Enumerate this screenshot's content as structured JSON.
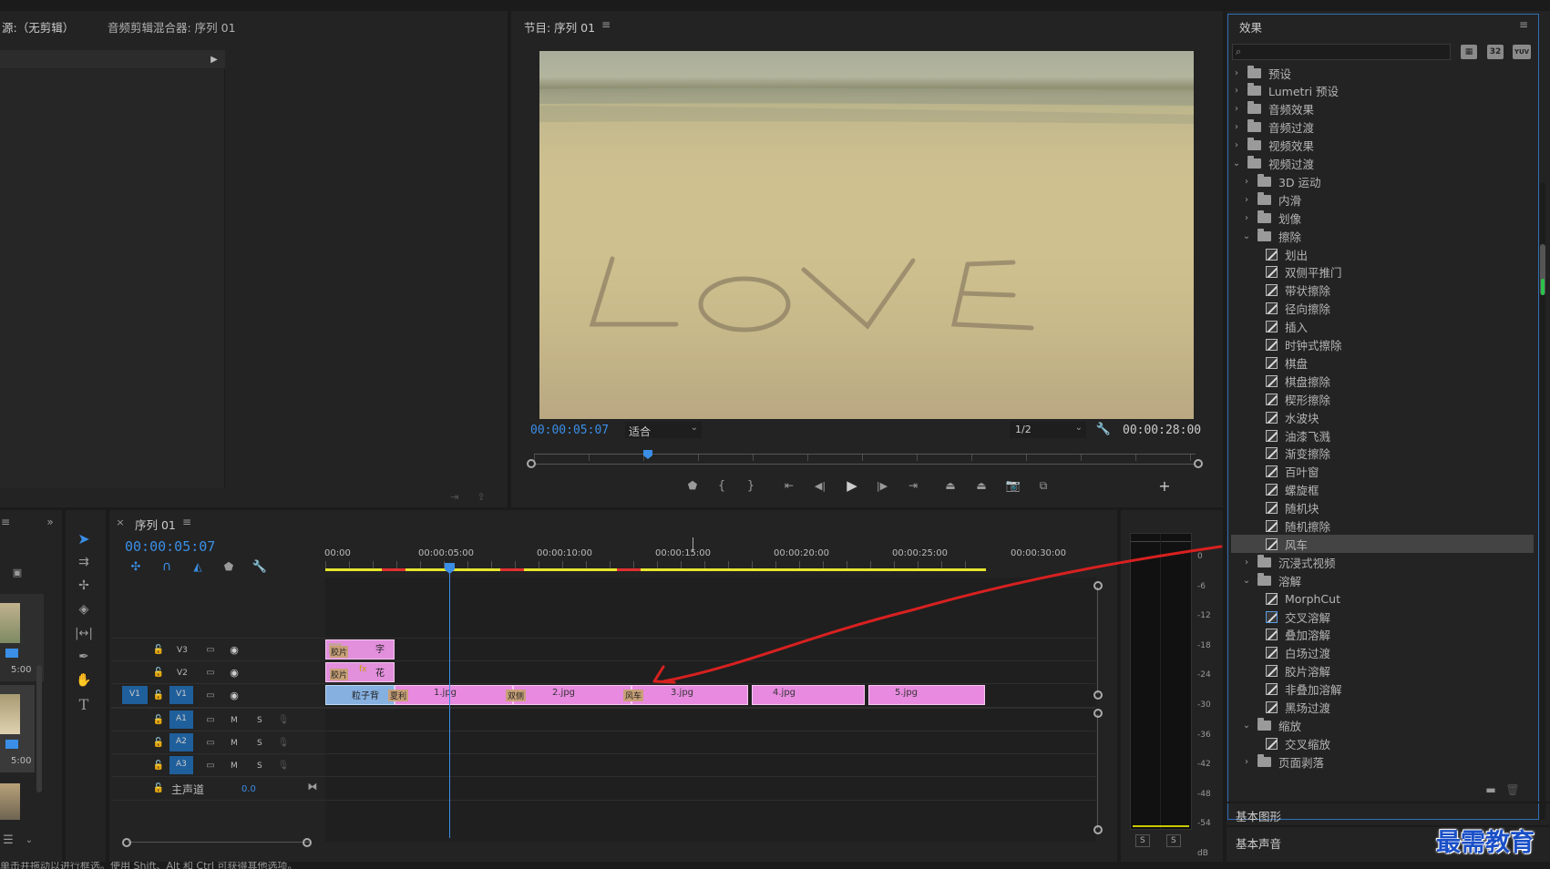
{
  "source_panel": {
    "tab_source": "源:（无剪辑）",
    "tab_audio_mixer": "音频剪辑混合器: 序列 01"
  },
  "program_monitor": {
    "title": "节目: 序列 01",
    "timecode": "00:00:05:07",
    "fit_label": "适合",
    "resolution": "1/2",
    "duration": "00:00:28:00"
  },
  "effects": {
    "title": "效果",
    "search_placeholder": "",
    "badges": [
      "32",
      "YUV"
    ],
    "items": [
      {
        "label": "预设",
        "type": "folder",
        "level": 0,
        "expanded": false
      },
      {
        "label": "Lumetri 预设",
        "type": "folder",
        "level": 0,
        "expanded": false
      },
      {
        "label": "音频效果",
        "type": "folder",
        "level": 0,
        "expanded": false
      },
      {
        "label": "音频过渡",
        "type": "folder",
        "level": 0,
        "expanded": false
      },
      {
        "label": "视频效果",
        "type": "folder",
        "level": 0,
        "expanded": false
      },
      {
        "label": "视频过渡",
        "type": "folder",
        "level": 0,
        "expanded": true
      },
      {
        "label": "3D 运动",
        "type": "folder",
        "level": 1,
        "expanded": false
      },
      {
        "label": "内滑",
        "type": "folder",
        "level": 1,
        "expanded": false
      },
      {
        "label": "划像",
        "type": "folder",
        "level": 1,
        "expanded": false
      },
      {
        "label": "擦除",
        "type": "folder",
        "level": 1,
        "expanded": true
      },
      {
        "label": "划出",
        "type": "effect",
        "level": 2
      },
      {
        "label": "双侧平推门",
        "type": "effect",
        "level": 2
      },
      {
        "label": "带状擦除",
        "type": "effect",
        "level": 2
      },
      {
        "label": "径向擦除",
        "type": "effect",
        "level": 2
      },
      {
        "label": "插入",
        "type": "effect",
        "level": 2
      },
      {
        "label": "时钟式擦除",
        "type": "effect",
        "level": 2
      },
      {
        "label": "棋盘",
        "type": "effect",
        "level": 2
      },
      {
        "label": "棋盘擦除",
        "type": "effect",
        "level": 2
      },
      {
        "label": "楔形擦除",
        "type": "effect",
        "level": 2
      },
      {
        "label": "水波块",
        "type": "effect",
        "level": 2
      },
      {
        "label": "油漆飞溅",
        "type": "effect",
        "level": 2
      },
      {
        "label": "渐变擦除",
        "type": "effect",
        "level": 2
      },
      {
        "label": "百叶窗",
        "type": "effect",
        "level": 2
      },
      {
        "label": "螺旋框",
        "type": "effect",
        "level": 2
      },
      {
        "label": "随机块",
        "type": "effect",
        "level": 2
      },
      {
        "label": "随机擦除",
        "type": "effect",
        "level": 2
      },
      {
        "label": "风车",
        "type": "effect",
        "level": 2,
        "selected": true
      },
      {
        "label": "沉浸式视频",
        "type": "folder",
        "level": 1,
        "expanded": false
      },
      {
        "label": "溶解",
        "type": "folder",
        "level": 1,
        "expanded": true
      },
      {
        "label": "MorphCut",
        "type": "effect",
        "level": 2
      },
      {
        "label": "交叉溶解",
        "type": "effect",
        "level": 2
      },
      {
        "label": "叠加溶解",
        "type": "effect",
        "level": 2
      },
      {
        "label": "白场过渡",
        "type": "effect",
        "level": 2
      },
      {
        "label": "胶片溶解",
        "type": "effect",
        "level": 2
      },
      {
        "label": "非叠加溶解",
        "type": "effect",
        "level": 2
      },
      {
        "label": "黑场过渡",
        "type": "effect",
        "level": 2
      },
      {
        "label": "缩放",
        "type": "folder",
        "level": 1,
        "expanded": true
      },
      {
        "label": "交叉缩放",
        "type": "effect",
        "level": 2
      },
      {
        "label": "页面剥落",
        "type": "folder",
        "level": 1,
        "expanded": false
      }
    ],
    "footer_panels": [
      "基本图形",
      "基本声音"
    ]
  },
  "timeline": {
    "tab": "序列 01",
    "timecode": "00:00:05:07",
    "ruler": [
      "00:00",
      "00:00:05:00",
      "00:00:10:00",
      "00:00:15:00",
      "00:00:20:00",
      "00:00:25:00",
      "00:00:30:00"
    ],
    "tracks": {
      "video": [
        "V3",
        "V2",
        "V1"
      ],
      "audio": [
        "A1",
        "A2",
        "A3"
      ],
      "source_patch": "V1",
      "master_label": "主声道",
      "master_value": "0.0",
      "m": "M",
      "s": "S"
    },
    "clips": {
      "v3_clip": "字",
      "v3_tag": "胶片",
      "v2_clip": "花",
      "v2_tag": "胶片",
      "v1_title": "粒子背",
      "v1_clips": [
        "1.jpg",
        "2.jpg",
        "3.jpg",
        "4.jpg",
        "5.jpg"
      ],
      "transitions": [
        "夏利",
        "双侧",
        "风车"
      ]
    }
  },
  "project_thumbs": [
    "5:00",
    "5:00"
  ],
  "audio_meter": {
    "scale": [
      "0",
      "-6",
      "-12",
      "-18",
      "-24",
      "-30",
      "-36",
      "-42",
      "-48",
      "-54",
      "dB"
    ],
    "solo": [
      "S",
      "S"
    ]
  },
  "watermark": "最需教育",
  "status_bar": "单击并拖动以进行框选。使用 Shift、Alt 和 Ctrl 可获得其他选项。"
}
